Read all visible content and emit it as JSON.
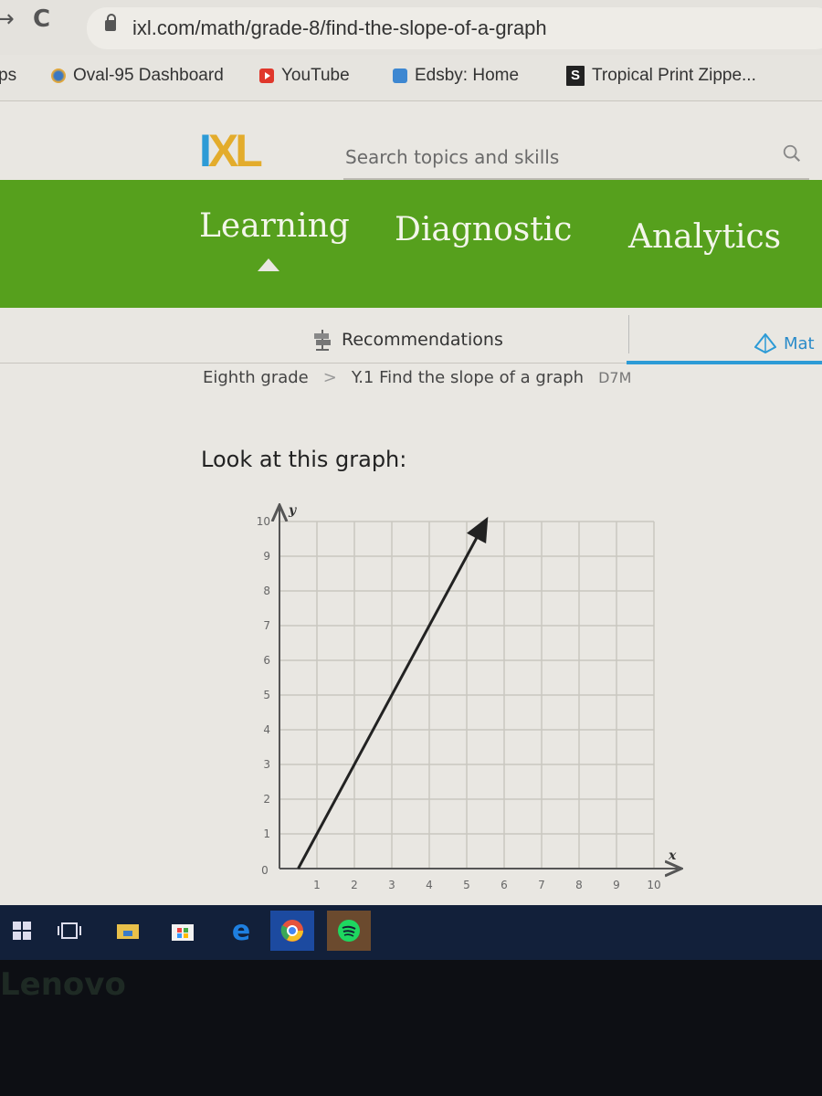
{
  "browser": {
    "url": "ixl.com/math/grade-8/find-the-slope-of-a-graph",
    "back_glyph": "→",
    "reload_glyph": "C",
    "bookmarks": [
      {
        "label": "ps",
        "icon": "apps-icon"
      },
      {
        "label": "Oval-95 Dashboard",
        "icon": "oval-icon"
      },
      {
        "label": "YouTube",
        "icon": "youtube-icon"
      },
      {
        "label": "Edsby: Home",
        "icon": "edsby-icon"
      },
      {
        "label": "Tropical Print Zippe...",
        "icon": "s-icon",
        "icon_text": "S"
      }
    ]
  },
  "header": {
    "logo_i": "I",
    "logo_xl": "XL",
    "search_placeholder": "Search topics and skills",
    "search_value": ""
  },
  "main_nav": {
    "tabs": [
      {
        "label": "Learning",
        "active": true
      },
      {
        "label": "Diagnostic",
        "active": false
      },
      {
        "label": "Analytics",
        "active": false
      }
    ],
    "accent_color": "#56a01d"
  },
  "sub_nav": {
    "recommendations": "Recommendations",
    "math": "Mat",
    "active_color": "#2d9bd6"
  },
  "breadcrumb": {
    "grade": "Eighth grade",
    "separator": ">",
    "skill": "Y.1 Find the slope of a graph",
    "code": "D7M"
  },
  "question": {
    "prompt": "Look at this graph:"
  },
  "chart_data": {
    "type": "line",
    "title": "",
    "xlabel": "x",
    "ylabel": "y",
    "xlim": [
      0,
      10
    ],
    "ylim": [
      0,
      10
    ],
    "grid": true,
    "x_ticks": [
      "0",
      "1",
      "2",
      "3",
      "4",
      "5",
      "6",
      "7",
      "8",
      "9",
      "10"
    ],
    "y_ticks": [
      "1",
      "2",
      "3",
      "4",
      "5",
      "6",
      "7",
      "8",
      "9",
      "10"
    ],
    "series": [
      {
        "name": "line",
        "points": [
          [
            0.5,
            0
          ],
          [
            5.5,
            10
          ]
        ],
        "arrow_end": true
      }
    ]
  },
  "taskbar": {
    "items": [
      "windows-start-icon",
      "task-view-icon",
      "file-explorer-icon",
      "store-icon",
      "edge-icon",
      "chrome-icon",
      "spotify-icon"
    ]
  },
  "device": {
    "brand": "Lenovo"
  }
}
